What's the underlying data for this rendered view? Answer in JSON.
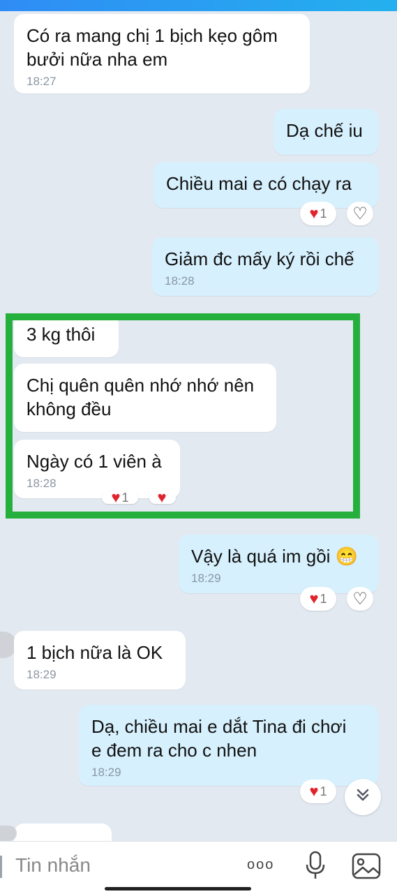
{
  "messages": [
    {
      "text": "Có ra mang chị 1 bịch kẹo gôm\nbưởi nữa nha em",
      "time": "18:27"
    },
    {
      "text": "Dạ chế iu"
    },
    {
      "text": "Chiều mai e có chạy ra",
      "reaction_count": "1"
    },
    {
      "text": "Giảm đc mấy ký rồi chế",
      "time": "18:28"
    },
    {
      "text": "3 kg thôi"
    },
    {
      "text": "Chị quên quên nhớ nhớ nên\nkhông đều"
    },
    {
      "text": "Ngày có 1 viên à",
      "time": "18:28",
      "reaction_count": "1"
    },
    {
      "text": "Vậy là quá im gồi 😁",
      "time": "18:29",
      "reaction_count": "1"
    },
    {
      "text": "1 bịch nữa là OK",
      "time": "18:29"
    },
    {
      "text": "Dạ, chiều mai e dắt Tina đi chơi\ne đem ra cho c nhen",
      "time": "18:29",
      "reaction_count": "1"
    }
  ],
  "composer": {
    "placeholder": "Tin nhắn",
    "more_glyph": "ooo"
  },
  "colors": {
    "incoming_bubble": "#ffffff",
    "outgoing_bubble": "#d6f0fd",
    "background": "#e3e9f1",
    "highlight_border": "#25b03d",
    "heart": "#e0242d"
  },
  "icons": [
    "heart-filled-icon",
    "heart-outline-icon",
    "chevron-double-down-icon",
    "more-icon",
    "microphone-icon",
    "image-icon"
  ]
}
